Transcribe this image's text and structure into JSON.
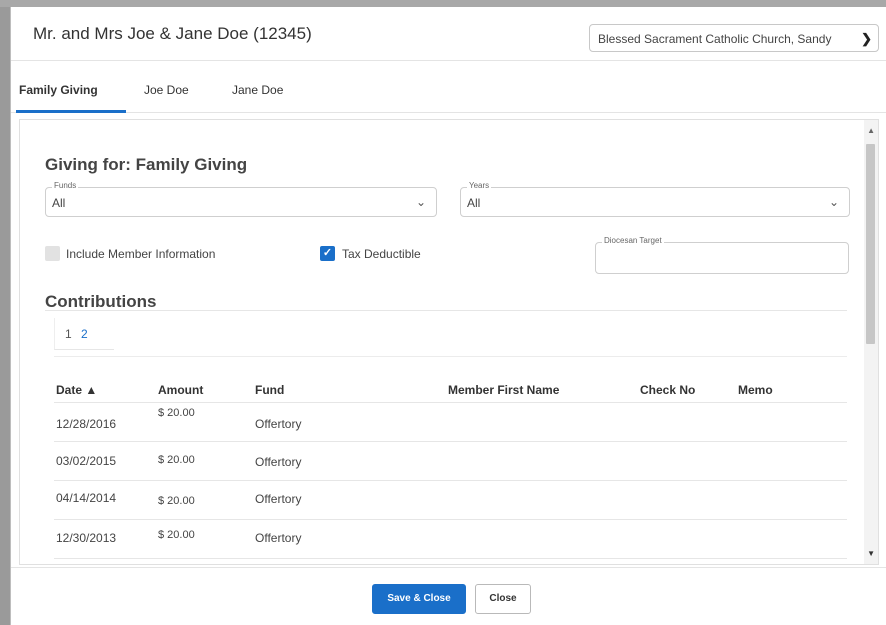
{
  "modal": {
    "title": "Mr. and Mrs Joe & Jane Doe (12345)",
    "parish_select": "Blessed Sacrament Catholic Church, Sandy"
  },
  "tabs": [
    {
      "label": "Family Giving",
      "active": true
    },
    {
      "label": "Joe Doe",
      "active": false
    },
    {
      "label": "Jane Doe",
      "active": false
    }
  ],
  "giving": {
    "title": "Giving for: Family Giving",
    "funds": {
      "label": "Funds",
      "value": "All"
    },
    "years": {
      "label": "Years",
      "value": "All"
    },
    "include_member_info": {
      "label": "Include Member Information",
      "checked": false
    },
    "tax_deductible": {
      "label": "Tax Deductible",
      "checked": true
    },
    "diocesan_target": {
      "label": "Diocesan Target",
      "value": ""
    }
  },
  "contributions": {
    "title": "Contributions",
    "pages": [
      "1",
      "2"
    ],
    "current_page": "2",
    "columns": [
      "Date ▲",
      "Amount",
      "Fund",
      "Member First Name",
      "Check No",
      "Memo"
    ],
    "rows": [
      {
        "date": "12/28/2016",
        "amount": "$ 20.00",
        "fund": "Offertory",
        "member": "",
        "check": "",
        "memo": ""
      },
      {
        "date": "03/02/2015",
        "amount": "$ 20.00",
        "fund": "Offertory",
        "member": "",
        "check": "",
        "memo": ""
      },
      {
        "date": "04/14/2014",
        "amount": "$ 20.00",
        "fund": "Offertory",
        "member": "",
        "check": "",
        "memo": ""
      },
      {
        "date": "12/30/2013",
        "amount": "$ 20.00",
        "fund": "Offertory",
        "member": "",
        "check": "",
        "memo": ""
      }
    ]
  },
  "footer": {
    "save_label": "Save & Close",
    "close_label": "Close"
  },
  "colors": {
    "accent": "#1a6fc9"
  },
  "icons": {
    "dropdown": "chevron-down-icon",
    "checkbox_checked": "check-icon",
    "sort": "sort-ascending-icon"
  }
}
